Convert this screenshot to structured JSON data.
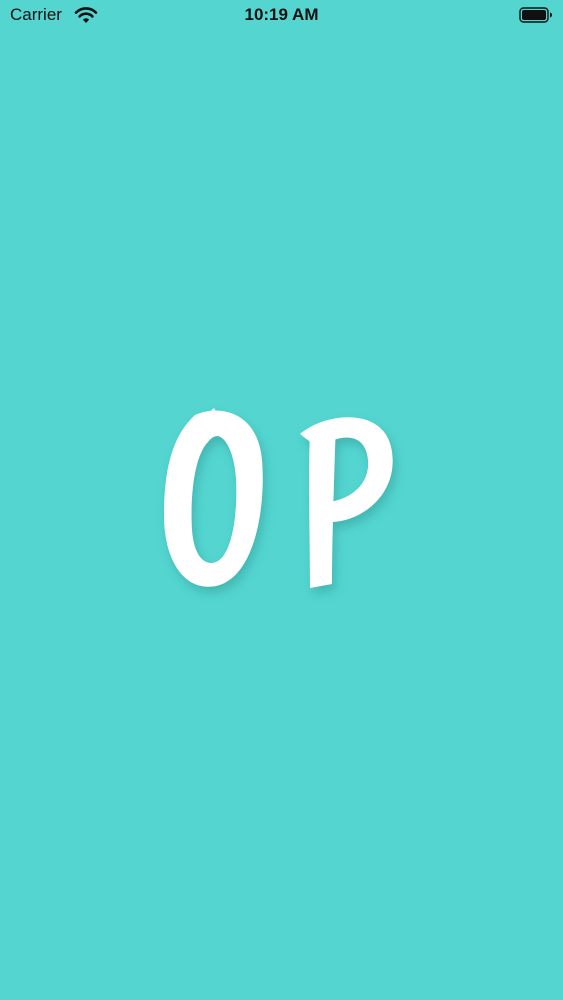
{
  "status_bar": {
    "carrier": "Carrier",
    "time": "10:19 AM",
    "icons": [
      "wifi-icon",
      "battery-icon"
    ]
  },
  "logo": {
    "text": "OP",
    "color": "#ffffff"
  },
  "colors": {
    "background": "#54d5d0",
    "status_text": "#111111"
  }
}
